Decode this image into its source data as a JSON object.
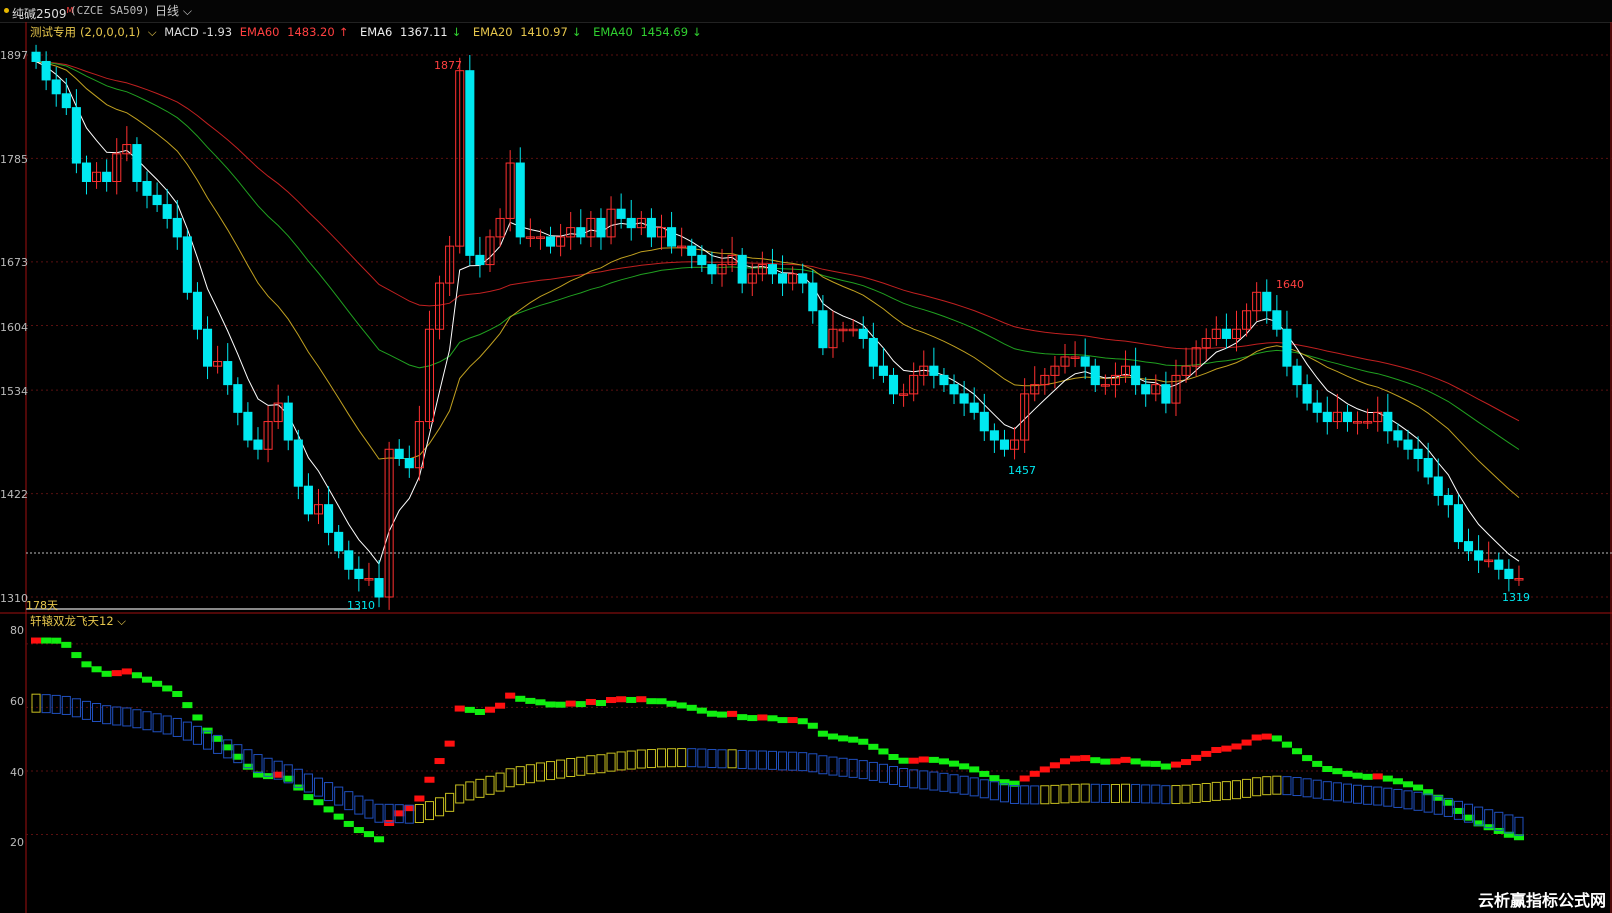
{
  "window": {
    "symbol": "纯碱2509",
    "symbol_sup": "M",
    "contract": "(CZCE SA509)",
    "period": "日线"
  },
  "main_legend": {
    "indicator": "测试专用",
    "params": "(2,0,0,0,1)",
    "macd": "MACD -1.93",
    "ema60_label": "EMA60",
    "ema60_value": "1483.20",
    "ema6_label": "EMA6",
    "ema6_value": "1367.11",
    "ema20_label": "EMA20",
    "ema20_value": "1410.97",
    "ema40_label": "EMA40",
    "ema40_value": "1454.69"
  },
  "price_axis_labels": [
    "1897",
    "1785",
    "1673",
    "1604",
    "1534",
    "1422",
    "1310"
  ],
  "price_annotations": [
    "1877",
    "1310",
    "1640",
    "1457",
    "1319"
  ],
  "days_label": "178天",
  "sub_legend": {
    "name": "轩辕双龙飞天12"
  },
  "sub_axis_labels": [
    "80",
    "60",
    "40",
    "20"
  ],
  "watermark": "云析赢指标公式网",
  "colors": {
    "up": "#ff3030",
    "down": "#00e8f0",
    "ema60": "#c02020",
    "ema40": "#20a020",
    "ema20": "#c0a020",
    "ema6": "#ffffff"
  },
  "chart_data": {
    "type": "candlestick",
    "ylim": [
      1310,
      1897
    ],
    "closes": [
      1890,
      1870,
      1855,
      1840,
      1780,
      1760,
      1770,
      1760,
      1790,
      1800,
      1760,
      1745,
      1735,
      1720,
      1700,
      1640,
      1600,
      1560,
      1565,
      1540,
      1510,
      1480,
      1470,
      1500,
      1520,
      1480,
      1430,
      1400,
      1410,
      1380,
      1360,
      1340,
      1330,
      1330,
      1310,
      1470,
      1460,
      1450,
      1500,
      1600,
      1650,
      1690,
      1880,
      1680,
      1670,
      1700,
      1720,
      1780,
      1700,
      1700,
      1700,
      1690,
      1700,
      1710,
      1700,
      1720,
      1700,
      1730,
      1720,
      1710,
      1720,
      1700,
      1710,
      1690,
      1690,
      1680,
      1670,
      1660,
      1670,
      1680,
      1650,
      1660,
      1670,
      1660,
      1650,
      1660,
      1650,
      1620,
      1580,
      1600,
      1600,
      1600,
      1590,
      1560,
      1550,
      1530,
      1530,
      1550,
      1560,
      1550,
      1540,
      1530,
      1520,
      1510,
      1490,
      1480,
      1470,
      1480,
      1530,
      1540,
      1550,
      1560,
      1570,
      1570,
      1560,
      1540,
      1540,
      1550,
      1560,
      1540,
      1530,
      1540,
      1520,
      1550,
      1560,
      1580,
      1590,
      1600,
      1590,
      1600,
      1620,
      1640,
      1620,
      1600,
      1560,
      1540,
      1520,
      1510,
      1500,
      1510,
      1500,
      1500,
      1500,
      1510,
      1490,
      1480,
      1470,
      1460,
      1440,
      1420,
      1410,
      1370,
      1360,
      1350,
      1350,
      1340,
      1330,
      1330
    ]
  }
}
